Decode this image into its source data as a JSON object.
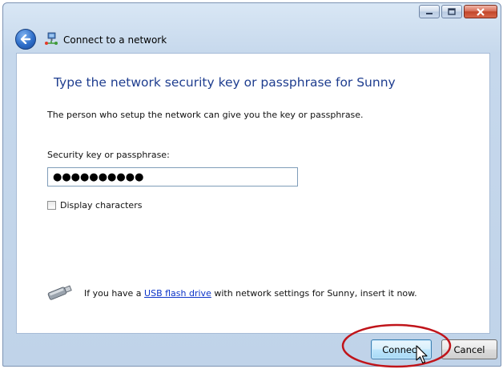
{
  "window": {
    "controls": {
      "minimize": "minimize-icon",
      "maximize": "maximize-icon",
      "close": "close-icon"
    }
  },
  "nav": {
    "back_icon": "back-arrow-icon",
    "network_icon": "network-icon",
    "title": "Connect to a network"
  },
  "main": {
    "heading": "Type the network security key or passphrase for Sunny",
    "subtext": "The person who setup the network can give you the key or passphrase.",
    "key_label": "Security key or passphrase:",
    "key_value": "●●●●●●●●●●",
    "display_characters_label": "Display characters",
    "display_characters_checked": false,
    "usb": {
      "icon": "usb-drive-icon",
      "text_before": "If you have a ",
      "link": "USB flash drive",
      "text_after": " with network settings for Sunny, insert it now."
    }
  },
  "buttons": {
    "connect": "Connect",
    "cancel": "Cancel"
  },
  "colors": {
    "heading": "#1e3d8f",
    "link": "#0d35c9",
    "annotation_circle": "#c0141a"
  }
}
